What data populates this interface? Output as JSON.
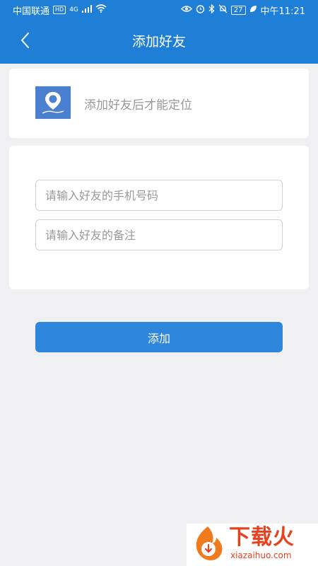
{
  "status_bar": {
    "carrier": "中国联通",
    "hd": "HD",
    "network": "4G",
    "battery": "27",
    "time": "中午11:21",
    "icons": [
      "eye-icon",
      "alarm-icon",
      "bluetooth-icon",
      "mute-icon",
      "leaf-icon"
    ]
  },
  "header": {
    "title": "添加好友",
    "back_icon": "chevron-left-icon"
  },
  "info_card": {
    "icon": "map-pin-icon",
    "text": "添加好友后才能定位"
  },
  "form": {
    "phone_placeholder": "请输入好友的手机号码",
    "note_placeholder": "请输入好友的备注"
  },
  "actions": {
    "add_label": "添加"
  },
  "watermark": {
    "brand": "下载火",
    "domain": "xiazaihuo.com"
  },
  "colors": {
    "primary": "#1f7fd6",
    "button": "#2d86dc",
    "background": "#f0f0f2",
    "watermark": "#e8411f"
  }
}
